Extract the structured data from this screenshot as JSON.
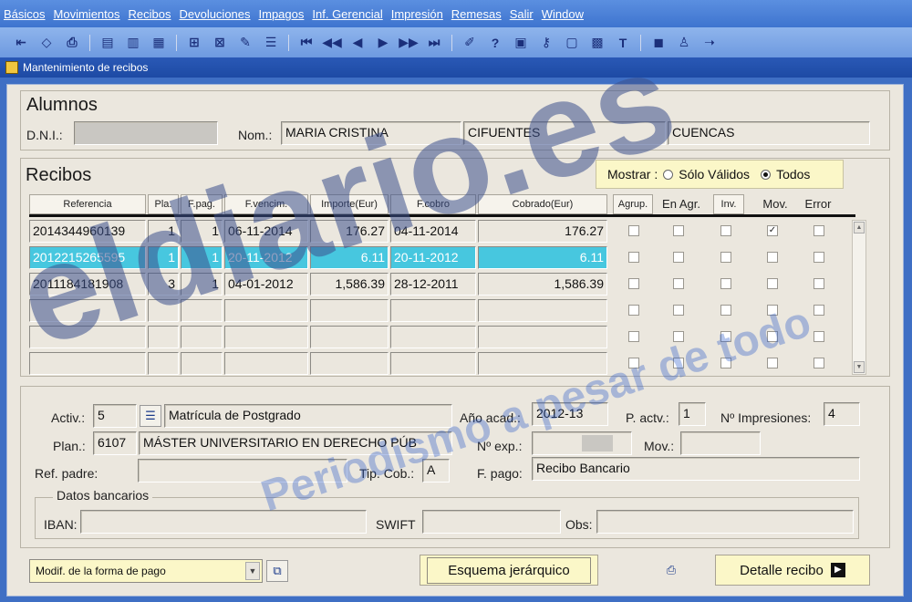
{
  "menu": [
    "Básicos",
    "Movimientos",
    "Recibos",
    "Devoluciones",
    "Impagos",
    "Inf. Gerencial",
    "Impresión",
    "Remesas",
    "Salir",
    "Window"
  ],
  "toolbar_icons": [
    "door-exit-icon",
    "eraser-icon",
    "print-icon",
    "doc-icon",
    "doc-query-icon",
    "doc-copy-icon",
    "insert-icon",
    "delete-icon",
    "edit-icon",
    "list-icon",
    "first-icon",
    "prev-set-icon",
    "prev-icon",
    "next-icon",
    "next-set-icon",
    "last-icon",
    "pencil-icon",
    "help-icon",
    "calc-icon",
    "key-icon",
    "calendar-icon",
    "grid-icon",
    "text-icon",
    "disk-icon",
    "person-icon",
    "arrow-icon"
  ],
  "form_title": "Mantenimiento de recibos",
  "alumnos": {
    "title": "Alumnos",
    "dni_label": "D.N.I.:",
    "nom_label": "Nom.:",
    "nombre": "MARIA CRISTINA",
    "apellido1": "CIFUENTES",
    "apellido2": "CUENCAS"
  },
  "recibos": {
    "title": "Recibos",
    "mostrar_label": "Mostrar :",
    "opt_validos": "Sólo Válidos",
    "opt_todos": "Todos",
    "headers": [
      "Referencia",
      "Pla.",
      "F.pag.",
      "F.vencim.",
      "Importe(Eur)",
      "F.cobro",
      "Cobrado(Eur)"
    ],
    "flag_headers": [
      "Agrup.",
      "En Agr.",
      "Inv.",
      "Mov.",
      "Error"
    ],
    "rows": [
      {
        "ref": "2014344960139",
        "pla": "1",
        "fpag": "1",
        "fvenc": "06-11-2014",
        "importe": "176.27",
        "fcobro": "04-11-2014",
        "cobrado": "176.27",
        "flags": [
          false,
          false,
          false,
          true,
          false
        ]
      },
      {
        "ref": "2012215265595",
        "pla": "1",
        "fpag": "1",
        "fvenc": "20-11-2012",
        "importe": "6.11",
        "fcobro": "20-11-2012",
        "cobrado": "6.11",
        "flags": [
          false,
          false,
          false,
          false,
          false
        ]
      },
      {
        "ref": "2011184181908",
        "pla": "3",
        "fpag": "1",
        "fvenc": "04-01-2012",
        "importe": "1,586.39",
        "fcobro": "28-12-2011",
        "cobrado": "1,586.39",
        "flags": [
          false,
          false,
          false,
          false,
          false
        ]
      }
    ]
  },
  "detalle": {
    "activ_label": "Activ.:",
    "activ": "5",
    "activ_desc": "Matrícula de Postgrado",
    "ano_label": "Año acad.:",
    "ano": "2012-13",
    "pactv_label": "P. actv.:",
    "pactv": "1",
    "nimp_label": "Nº Impresiones:",
    "nimp": "4",
    "plan_label": "Plan.:",
    "plan": "6107",
    "plan_desc": "MÁSTER UNIVERSITARIO EN DERECHO PÚB",
    "nexp_label": "Nº exp.:",
    "mov_label": "Mov.:",
    "refpadre_label": "Ref. padre:",
    "tipcob_label": "Tip. Cob.:",
    "tipcob": "A",
    "fpago_label": "F. pago:",
    "fpago": "Recibo Bancario",
    "bancarios_legend": "Datos bancarios",
    "iban_label": "IBAN:",
    "swift_label": "SWIFT",
    "obs_label": "Obs:"
  },
  "bottom": {
    "dropdown": "Modif. de la forma de pago",
    "esquema": "Esquema jerárquico",
    "detalle": "Detalle recibo"
  },
  "watermark": {
    "logo": "eldiario.es",
    "tagline": "Periodismo a pesar de todo"
  }
}
